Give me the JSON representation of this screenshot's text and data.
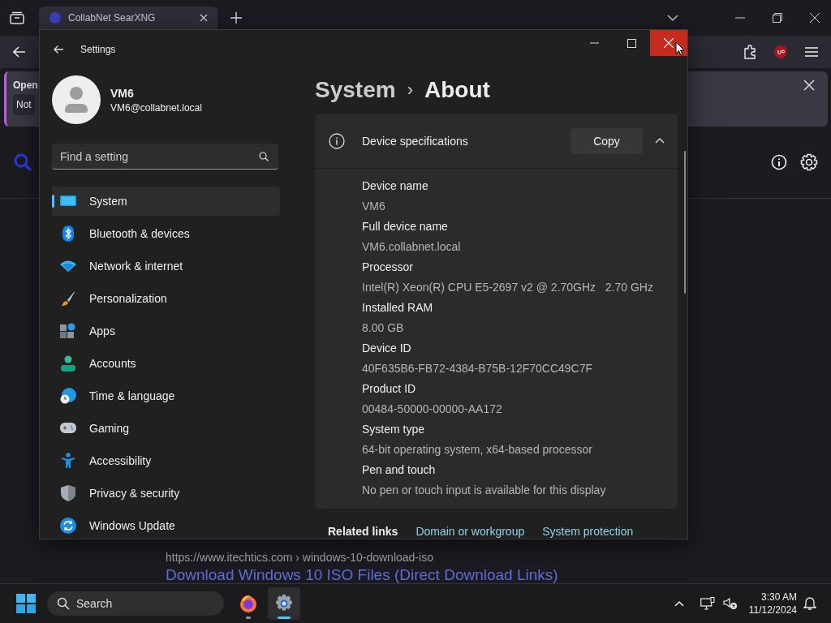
{
  "browser": {
    "tabs": [
      {
        "title": "CollabNet SearXNG",
        "selected": true
      }
    ],
    "notification": {
      "title": "Open",
      "button": "Not"
    },
    "result": {
      "url": "https://www.itechtics.com",
      "path": "› windows-10-download-iso",
      "title": "Download Windows 10 ISO Files (Direct Download Links)"
    }
  },
  "settings": {
    "title": "Settings",
    "user": {
      "name": "VM6",
      "email": "VM6@collabnet.local"
    },
    "search": {
      "placeholder": "Find a setting"
    },
    "nav": [
      {
        "label": "System",
        "kind": "system",
        "selected": true
      },
      {
        "label": "Bluetooth & devices",
        "kind": "bluetooth",
        "selected": false
      },
      {
        "label": "Network & internet",
        "kind": "network",
        "selected": false
      },
      {
        "label": "Personalization",
        "kind": "personalization",
        "selected": false
      },
      {
        "label": "Apps",
        "kind": "apps",
        "selected": false
      },
      {
        "label": "Accounts",
        "kind": "accounts",
        "selected": false
      },
      {
        "label": "Time & language",
        "kind": "time",
        "selected": false
      },
      {
        "label": "Gaming",
        "kind": "gaming",
        "selected": false
      },
      {
        "label": "Accessibility",
        "kind": "accessibility",
        "selected": false
      },
      {
        "label": "Privacy & security",
        "kind": "privacy",
        "selected": false
      },
      {
        "label": "Windows Update",
        "kind": "update",
        "selected": false
      }
    ],
    "breadcrumb": {
      "parent": "System",
      "separator": "›",
      "current": "About"
    },
    "specs": {
      "title": "Device specifications",
      "copy_button": "Copy",
      "expanded": true,
      "items": [
        {
          "label": "Device name",
          "value": "VM6"
        },
        {
          "label": "Full device name",
          "value": "VM6.collabnet.local"
        },
        {
          "label": "Processor",
          "value": "Intel(R) Xeon(R) CPU E5-2697 v2 @ 2.70GHz   2.70 GHz"
        },
        {
          "label": "Installed RAM",
          "value": "8.00 GB"
        },
        {
          "label": "Device ID",
          "value": "40F635B6-FB72-4384-B75B-12F70CC49C7F"
        },
        {
          "label": "Product ID",
          "value": "00484-50000-00000-AA172"
        },
        {
          "label": "System type",
          "value": "64-bit operating system, x64-based processor"
        },
        {
          "label": "Pen and touch",
          "value": "No pen or touch input is available for this display"
        }
      ]
    },
    "related": {
      "title": "Related links",
      "links": [
        "Domain or workgroup",
        "System protection"
      ]
    }
  },
  "taskbar": {
    "search": {
      "placeholder": "Search"
    },
    "apps": [
      {
        "kind": "firefox",
        "selected": false
      },
      {
        "kind": "settings",
        "selected": true
      }
    ],
    "clock": {
      "time": "3:30 AM",
      "date": "11/12/2024"
    }
  }
}
